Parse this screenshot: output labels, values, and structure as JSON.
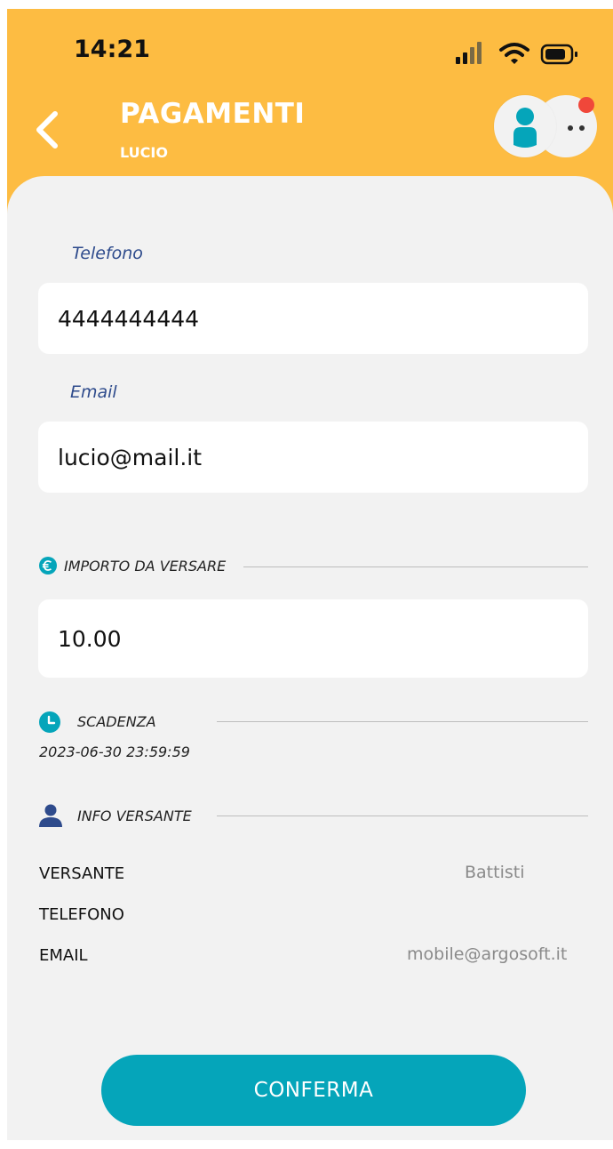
{
  "status_bar": {
    "time": "14:21"
  },
  "header": {
    "title": "PAGAMENTI",
    "subtitle": "LUCIO"
  },
  "form": {
    "phone_label": "Telefono",
    "phone_value": "4444444444",
    "email_label": "Email",
    "email_value": "lucio@mail.it"
  },
  "amount": {
    "section_label": "IMPORTO DA VERSARE",
    "value": "10.00"
  },
  "deadline": {
    "section_label": "SCADENZA",
    "value": "2023-06-30 23:59:59"
  },
  "payer_info": {
    "section_label": "INFO VERSANTE",
    "rows": [
      {
        "key": "VERSANTE",
        "value": "Battisti"
      },
      {
        "key": "TELEFONO",
        "value": ""
      },
      {
        "key": "EMAIL",
        "value": "mobile@argosoft.it"
      }
    ]
  },
  "confirm_label": "CONFERMA",
  "colors": {
    "header_bg": "#FDBC42",
    "accent": "#05A5BA",
    "label_blue": "#2E4B8C",
    "notification": "#F0473A",
    "background": "#F2F2F2"
  },
  "icons": [
    "back-chevron-icon",
    "user-icon",
    "more-icon",
    "euro-icon",
    "clock-icon",
    "person-icon",
    "signal-icon",
    "wifi-icon",
    "battery-icon"
  ]
}
